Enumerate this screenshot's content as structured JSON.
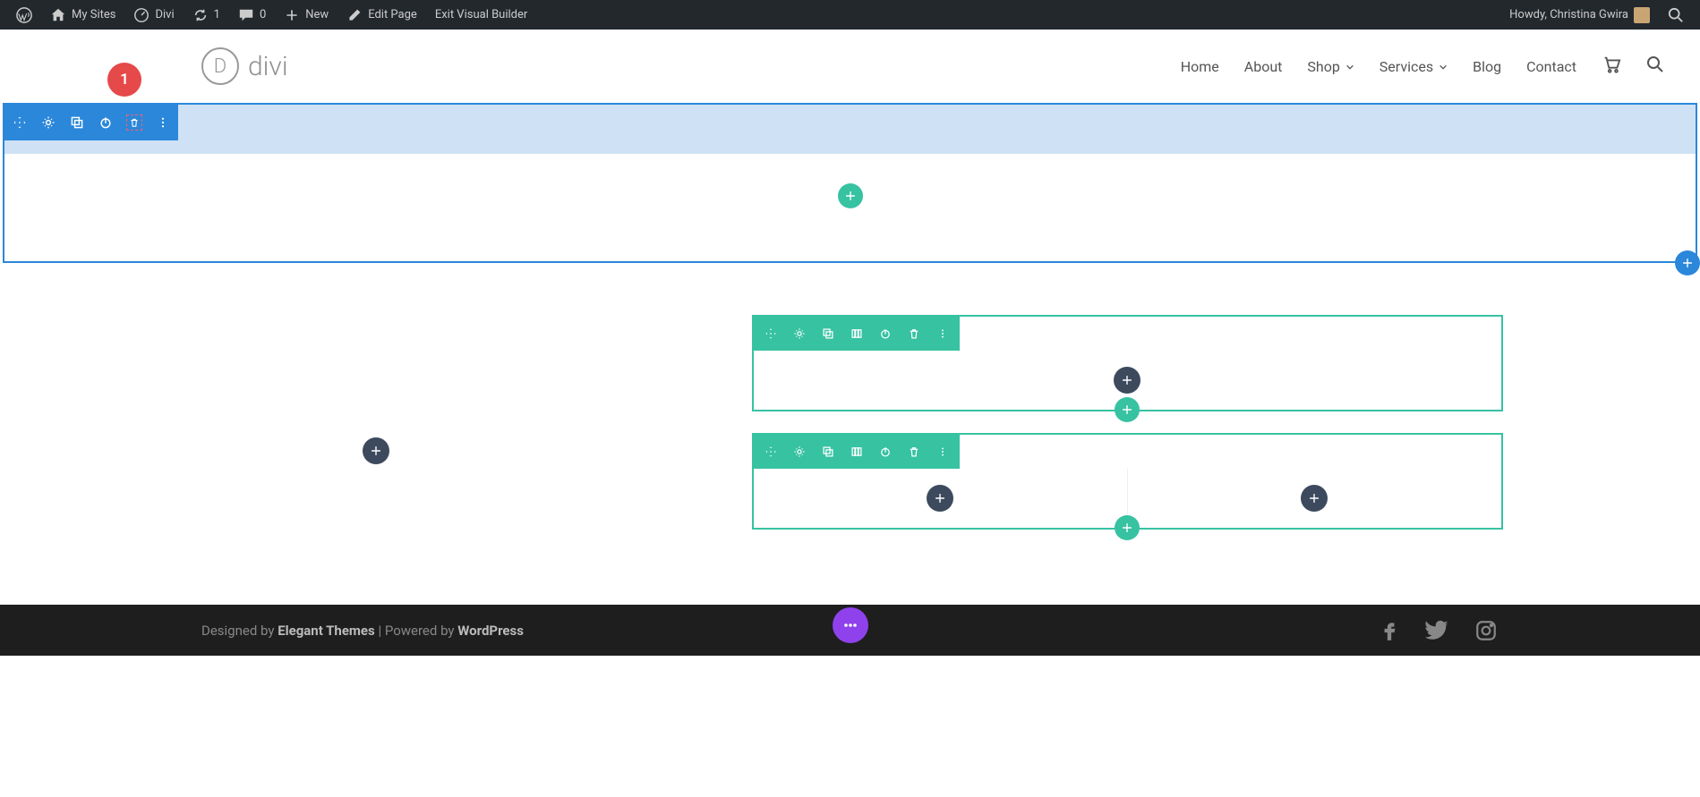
{
  "admin_bar": {
    "my_sites": "My Sites",
    "site_name": "Divi",
    "updates_count": "1",
    "comments_count": "0",
    "new_label": "New",
    "edit_page": "Edit Page",
    "exit_vb": "Exit Visual Builder",
    "howdy": "Howdy, Christina Gwira"
  },
  "logo": {
    "letter": "D",
    "text": "divi"
  },
  "nav": {
    "home": "Home",
    "about": "About",
    "shop": "Shop",
    "services": "Services",
    "blog": "Blog",
    "contact": "Contact"
  },
  "annotation": {
    "num": "1"
  },
  "footer": {
    "designed_by": "Designed by ",
    "elegant": "Elegant Themes",
    "powered": " | Powered by ",
    "wordpress": "WordPress"
  },
  "colors": {
    "blue": "#2b87da",
    "teal": "#37c2a2",
    "dark": "#3d4a5e",
    "purple": "#8f42ec",
    "red": "#e64949"
  }
}
